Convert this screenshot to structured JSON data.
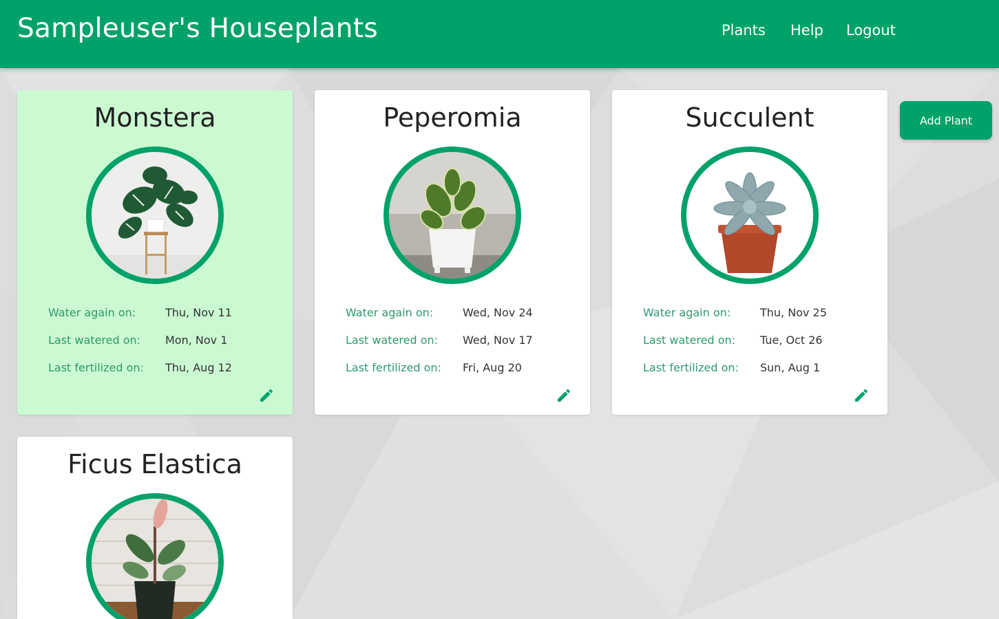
{
  "app": {
    "title": "Sampleuser's Houseplants"
  },
  "nav": {
    "plants": "Plants",
    "help": "Help",
    "logout": "Logout"
  },
  "actions": {
    "add_plant": "Add Plant"
  },
  "labels": {
    "water_again": "Water again on:",
    "last_watered": "Last watered on:",
    "last_fertilized": "Last fertilized on:"
  },
  "colors": {
    "brand": "#01a269",
    "highlight_card": "#cbfad2",
    "label_text": "#2c9a6b"
  },
  "plants": [
    {
      "name": "Monstera",
      "water_again": "Thu, Nov 11",
      "last_watered": "Mon, Nov 1",
      "last_fertilized": "Thu, Aug 12",
      "highlighted": true,
      "edit_icon": "pencil-icon"
    },
    {
      "name": "Peperomia",
      "water_again": "Wed, Nov 24",
      "last_watered": "Wed, Nov 17",
      "last_fertilized": "Fri, Aug 20",
      "highlighted": false,
      "edit_icon": "pencil-icon"
    },
    {
      "name": "Succulent",
      "water_again": "Thu, Nov 25",
      "last_watered": "Tue, Oct 26",
      "last_fertilized": "Sun, Aug 1",
      "highlighted": false,
      "edit_icon": "pencil-icon"
    },
    {
      "name": "Ficus Elastica",
      "highlighted": false
    }
  ]
}
